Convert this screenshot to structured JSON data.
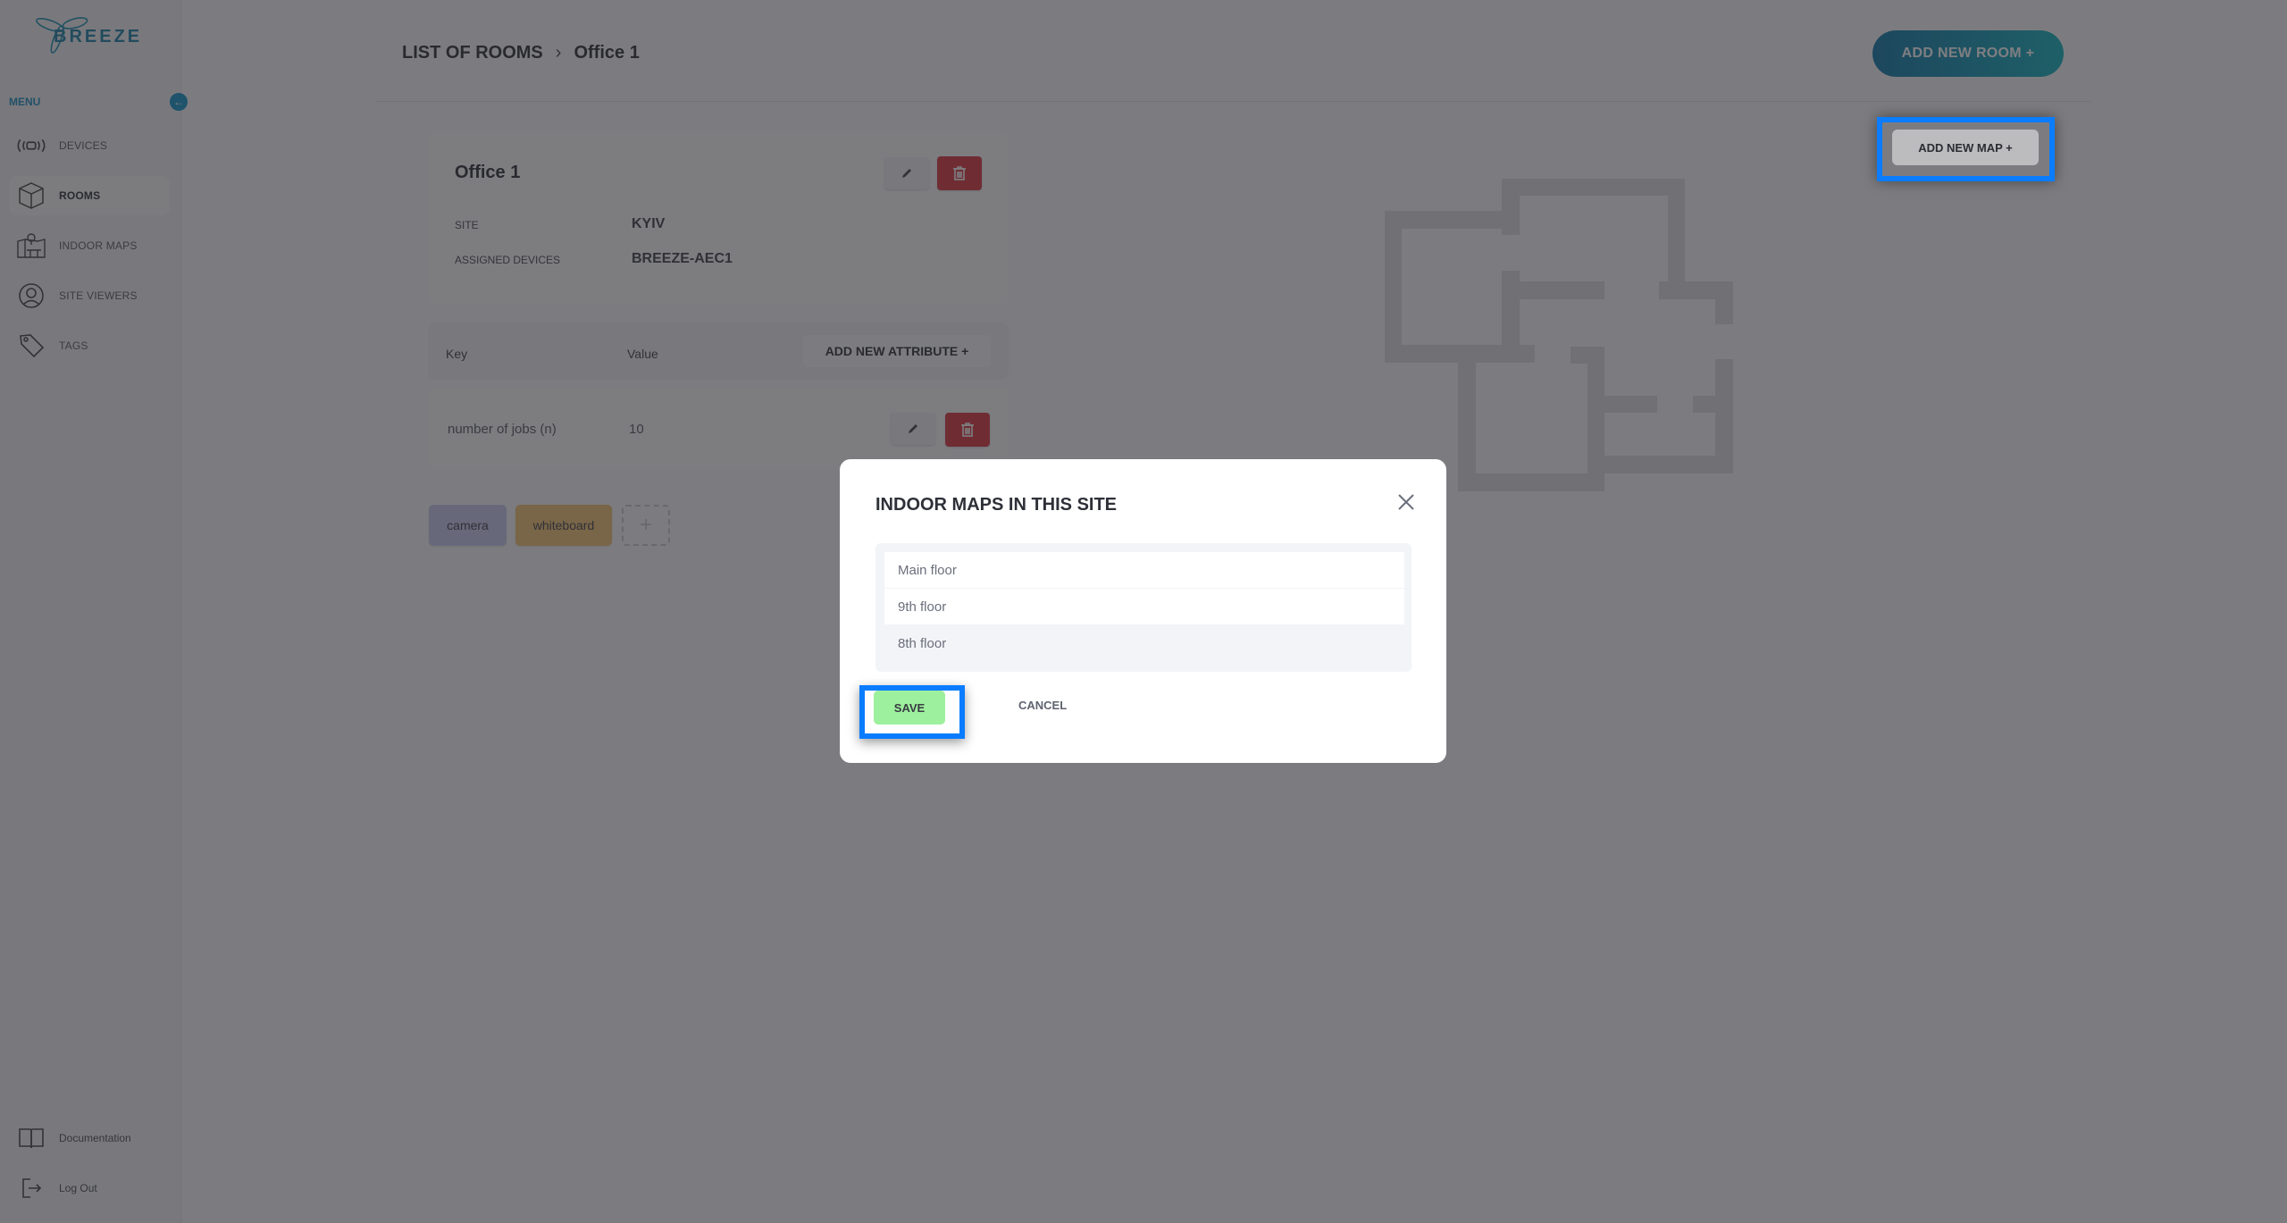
{
  "brand": {
    "name": "BREEZE",
    "accent": "#1b8dbd"
  },
  "sidebar": {
    "menu_label": "MENU",
    "collapse_icon": "arrow-left-icon",
    "items": [
      {
        "label": "DEVICES",
        "icon": "devices-signal-icon",
        "active": false
      },
      {
        "label": "ROOMS",
        "icon": "cube-icon",
        "active": true
      },
      {
        "label": "INDOOR MAPS",
        "icon": "indoor-map-icon",
        "active": false
      },
      {
        "label": "SITE VIEWERS",
        "icon": "user-circle-icon",
        "active": false
      },
      {
        "label": "TAGS",
        "icon": "tag-icon",
        "active": false
      }
    ],
    "footer": [
      {
        "label": "Documentation",
        "icon": "book-icon"
      },
      {
        "label": "Log Out",
        "icon": "logout-icon"
      }
    ]
  },
  "header": {
    "breadcrumb": {
      "parent": "LIST OF ROOMS",
      "current": "Office 1"
    },
    "add_room_label": "ADD NEW ROOM  +",
    "add_map_label": "ADD NEW MAP  +"
  },
  "room": {
    "title": "Office 1",
    "fields": [
      {
        "label": "SITE",
        "value": "KYIV"
      },
      {
        "label": "ASSIGNED DEVICES",
        "value": "BREEZE-AEC1"
      }
    ]
  },
  "attributes": {
    "key_header": "Key",
    "value_header": "Value",
    "add_label": "ADD NEW ATTRIBUTE  +",
    "rows": [
      {
        "key": "number of jobs (n)",
        "value": "10"
      }
    ]
  },
  "tags": [
    {
      "label": "camera",
      "color": "#c9c9f0"
    },
    {
      "label": "whiteboard",
      "color": "#f2c270"
    }
  ],
  "tag_add_label": "+",
  "modal": {
    "title": "INDOOR MAPS IN THIS SITE",
    "maps": [
      {
        "label": "Main floor",
        "selected": false
      },
      {
        "label": "9th floor",
        "selected": false
      },
      {
        "label": "8th floor",
        "selected": true
      }
    ],
    "save_label": "SAVE",
    "cancel_label": "CANCEL"
  }
}
